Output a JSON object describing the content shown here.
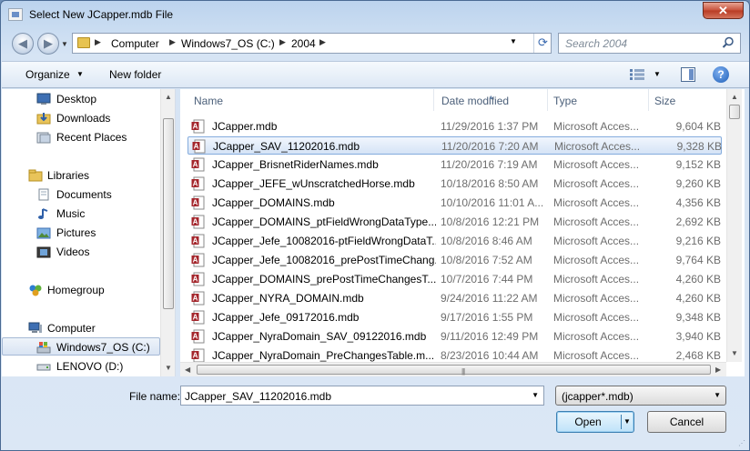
{
  "window": {
    "title": "Select New JCapper.mdb File",
    "close_glyph": "✕"
  },
  "nav": {
    "back_glyph": "◀",
    "forward_glyph": "▶",
    "breadcrumbs": [
      "Computer",
      "Windows7_OS (C:)",
      "2004"
    ],
    "search_placeholder": "Search 2004"
  },
  "toolbar": {
    "organize": "Organize",
    "new_folder": "New folder",
    "help": "?"
  },
  "sidebar": {
    "items": [
      {
        "label": "Desktop",
        "icon": "desktop-icon"
      },
      {
        "label": "Downloads",
        "icon": "downloads-icon"
      },
      {
        "label": "Recent Places",
        "icon": "recent-places-icon"
      },
      {
        "label": "Libraries",
        "icon": "libraries-icon"
      },
      {
        "label": "Documents",
        "icon": "documents-icon"
      },
      {
        "label": "Music",
        "icon": "music-icon"
      },
      {
        "label": "Pictures",
        "icon": "pictures-icon"
      },
      {
        "label": "Videos",
        "icon": "videos-icon"
      },
      {
        "label": "Homegroup",
        "icon": "homegroup-icon"
      },
      {
        "label": "Computer",
        "icon": "computer-icon"
      },
      {
        "label": "Windows7_OS (C:)",
        "icon": "drive-icon"
      },
      {
        "label": "LENOVO (D:)",
        "icon": "drive-icon"
      }
    ],
    "selected": "Windows7_OS (C:)"
  },
  "columns": {
    "name": "Name",
    "date": "Date modified",
    "type": "Type",
    "size": "Size"
  },
  "files": [
    {
      "name": "JCapper.mdb",
      "date": "11/29/2016 1:37 PM",
      "type": "Microsoft Acces...",
      "size": "9,604 KB"
    },
    {
      "name": "JCapper_SAV_11202016.mdb",
      "date": "11/20/2016 7:20 AM",
      "type": "Microsoft Acces...",
      "size": "9,328 KB"
    },
    {
      "name": "JCapper_BrisnetRiderNames.mdb",
      "date": "11/20/2016 7:19 AM",
      "type": "Microsoft Acces...",
      "size": "9,152 KB"
    },
    {
      "name": "JCapper_JEFE_wUnscratchedHorse.mdb",
      "date": "10/18/2016 8:50 AM",
      "type": "Microsoft Acces...",
      "size": "9,260 KB"
    },
    {
      "name": "JCapper_DOMAINS.mdb",
      "date": "10/10/2016 11:01 A...",
      "type": "Microsoft Acces...",
      "size": "4,356 KB"
    },
    {
      "name": "JCapper_DOMAINS_ptFieldWrongDataType...",
      "date": "10/8/2016 12:21 PM",
      "type": "Microsoft Acces...",
      "size": "2,692 KB"
    },
    {
      "name": "JCapper_Jefe_10082016-ptFieldWrongDataT...",
      "date": "10/8/2016 8:46 AM",
      "type": "Microsoft Acces...",
      "size": "9,216 KB"
    },
    {
      "name": "JCapper_Jefe_10082016_prePostTimeChang...",
      "date": "10/8/2016 7:52 AM",
      "type": "Microsoft Acces...",
      "size": "9,764 KB"
    },
    {
      "name": "JCapper_DOMAINS_prePostTimeChangesT...",
      "date": "10/7/2016 7:44 PM",
      "type": "Microsoft Acces...",
      "size": "4,260 KB"
    },
    {
      "name": "JCapper_NYRA_DOMAIN.mdb",
      "date": "9/24/2016 11:22 AM",
      "type": "Microsoft Acces...",
      "size": "4,260 KB"
    },
    {
      "name": "JCapper_Jefe_09172016.mdb",
      "date": "9/17/2016 1:55 PM",
      "type": "Microsoft Acces...",
      "size": "9,348 KB"
    },
    {
      "name": "JCapper_NyraDomain_SAV_09122016.mdb",
      "date": "9/11/2016 12:49 PM",
      "type": "Microsoft Acces...",
      "size": "3,940 KB"
    },
    {
      "name": "JCapper_NyraDomain_PreChangesTable.m...",
      "date": "8/23/2016 10:44 AM",
      "type": "Microsoft Acces...",
      "size": "2,468 KB"
    }
  ],
  "selected_file_index": 1,
  "footer": {
    "file_name_label": "File name:",
    "file_name_value": "JCapper_SAV_11202016.mdb",
    "filter_value": "(jcapper*.mdb)",
    "open": "Open",
    "cancel": "Cancel"
  }
}
